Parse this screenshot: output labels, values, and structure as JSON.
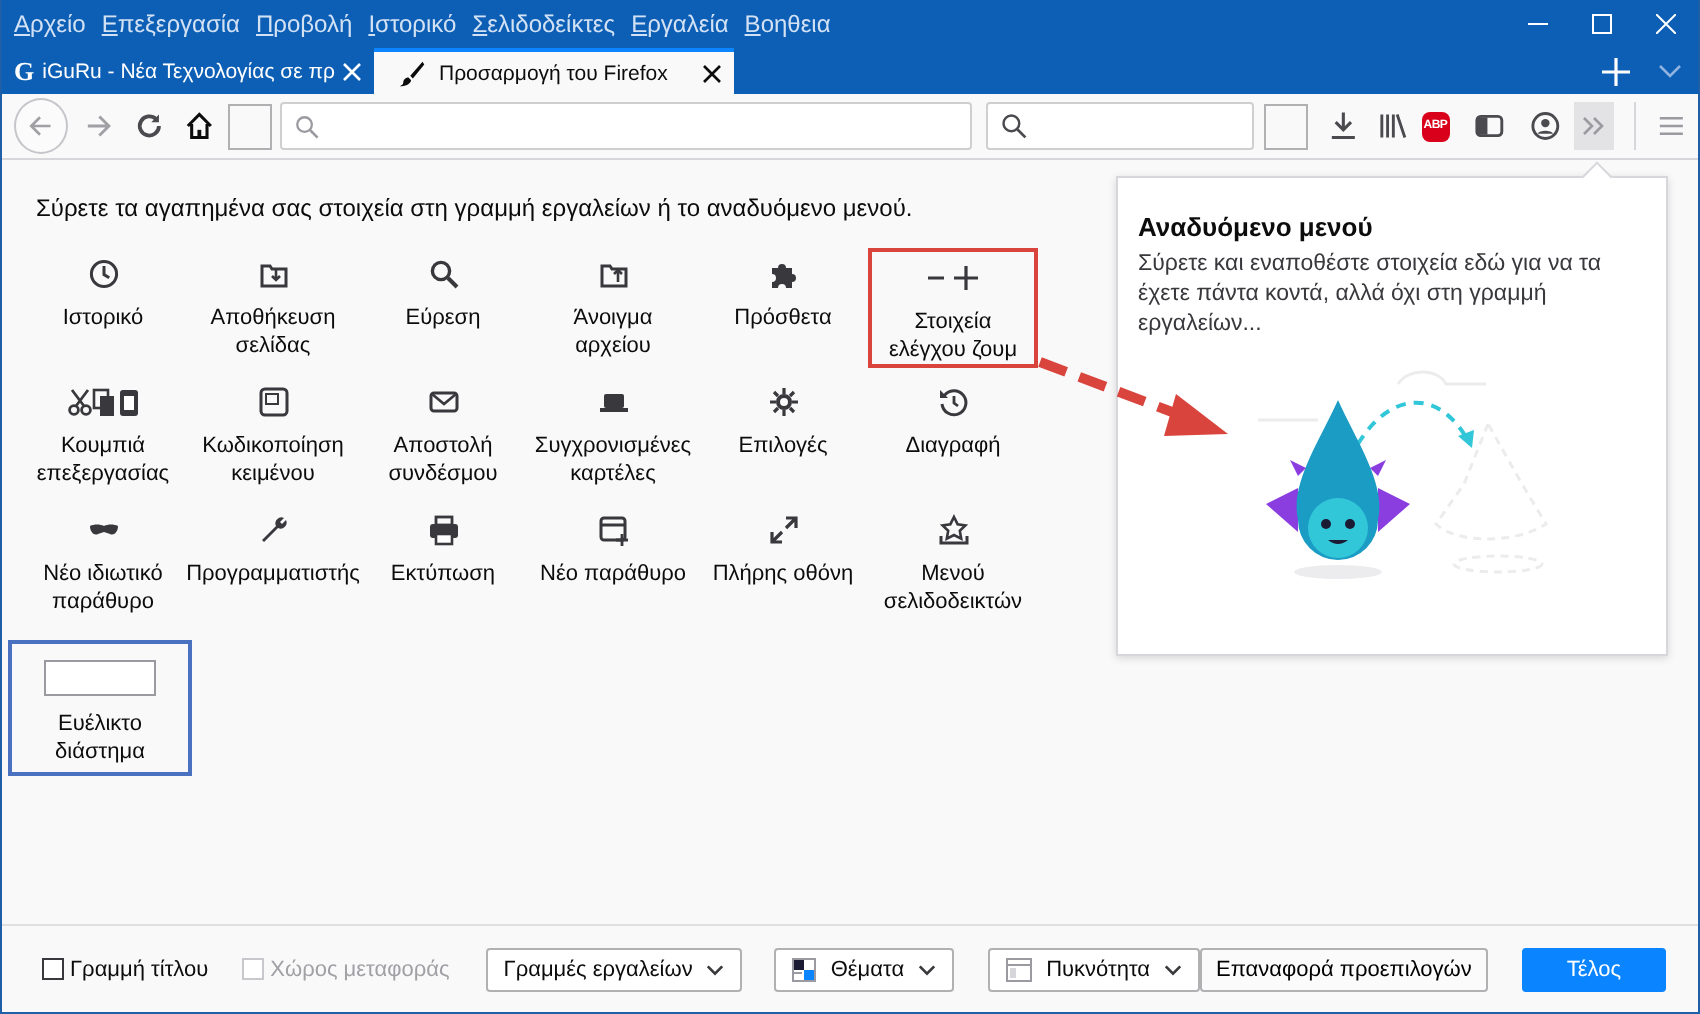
{
  "menu_bar": [
    "Αρχείο",
    "Επεξεργασία",
    "Προβολή",
    "Ιστορικό",
    "Σελιδοδείκτες",
    "Εργαλεία",
    "Βοηθεια"
  ],
  "tabs": [
    {
      "kind": "site",
      "favicon": "G",
      "title": "iGuRu - Νέα Τεχνολογίας σε πρ",
      "selected": false
    },
    {
      "kind": "customize",
      "title": "Προσαρμογή του Firefox",
      "selected": true
    }
  ],
  "toolbar": {
    "abp_label": "ABP"
  },
  "instructions": "Σύρετε τα αγαπημένα σας στοιχεία στη γραμμή εργαλείων ή το αναδυόμενο μενού.",
  "palette": [
    {
      "kind": "button",
      "label": "Ιστορικό"
    },
    {
      "kind": "button",
      "label": "Αποθήκευση σελίδας"
    },
    {
      "kind": "button",
      "label": "Εύρεση"
    },
    {
      "kind": "button",
      "label": "Άνοιγμα αρχείου"
    },
    {
      "kind": "button",
      "label": "Πρόσθετα"
    },
    {
      "kind": "button",
      "label": "Στοιχεία ελέγχου ζουμ",
      "color": "#d9453c"
    },
    {
      "kind": "button",
      "label": "Κουμπιά επεξεργασίας"
    },
    {
      "kind": "button",
      "label": "Κωδικοποίηση κειμένου"
    },
    {
      "kind": "button",
      "label": "Αποστολή συνδέσμου"
    },
    {
      "kind": "button",
      "label": "Συγχρονισμένες καρτέλες"
    },
    {
      "kind": "button",
      "label": "Επιλογές"
    },
    {
      "kind": "button",
      "label": "Διαγραφή"
    },
    {
      "kind": "button",
      "label": "Νέο ιδιωτικό παράθυρο"
    },
    {
      "kind": "button",
      "label": "Προγραμματιστής"
    },
    {
      "kind": "button",
      "label": "Εκτύπωση"
    },
    {
      "kind": "button",
      "label": "Νέο παράθυρο"
    },
    {
      "kind": "button",
      "label": "Πλήρης οθόνη"
    },
    {
      "kind": "button",
      "label": "Μενού σελιδοδεικτών"
    },
    {
      "kind": "spacer",
      "label": "Ευέλικτο διάστημα",
      "color": "#4a72c0"
    }
  ],
  "overflow_panel": {
    "title": "Αναδυόμενο μενού",
    "description": "Σύρετε και εναποθέστε στοιχεία εδώ για να τα έχετε πάντα κοντά, αλλά όχι στη γραμμή εργαλείων..."
  },
  "footer": {
    "checkboxes": [
      {
        "label": "Γραμμή τίτλου",
        "checked": false,
        "disabled": false
      },
      {
        "label": "Χώρος μεταφοράς",
        "checked": false,
        "disabled": true
      }
    ],
    "dropdowns": [
      {
        "kind": "plain",
        "label": "Γραμμές εργαλείων"
      },
      {
        "kind": "themes",
        "label": "Θέματα"
      },
      {
        "kind": "density",
        "label": "Πυκνότητα"
      }
    ],
    "buttons": [
      {
        "kind": "secondary",
        "label": "Επαναφορά προεπιλογών"
      },
      {
        "kind": "primary",
        "label": "Τέλος"
      }
    ]
  }
}
